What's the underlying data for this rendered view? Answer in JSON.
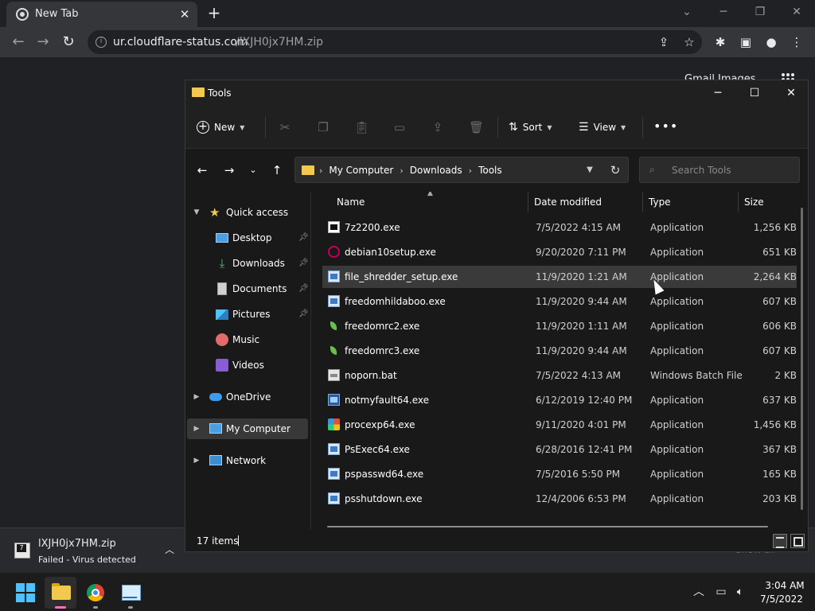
{
  "browser": {
    "tab_title": "New Tab",
    "tab_close": "✕",
    "new_tab": "+",
    "url_host": "ur.cloudflare-status.com",
    "url_path": "/lXJH0jx7HM.zip",
    "ntp_links": "Gmail   Images"
  },
  "download": {
    "filename": "lXJH0jx7HM.zip",
    "status": "Failed - Virus detected",
    "show_all": "Show all"
  },
  "explorer": {
    "title": "Tools",
    "cmd": {
      "new": "New",
      "sort": "Sort",
      "view": "View"
    },
    "breadcrumb": [
      "My Computer",
      "Downloads",
      "Tools"
    ],
    "search_placeholder": "Search Tools",
    "nav": {
      "quick_access": "Quick access",
      "desktop": "Desktop",
      "downloads": "Downloads",
      "documents": "Documents",
      "pictures": "Pictures",
      "music": "Music",
      "videos": "Videos",
      "onedrive": "OneDrive",
      "my_computer": "My Computer",
      "network": "Network"
    },
    "columns": {
      "name": "Name",
      "date": "Date modified",
      "type": "Type",
      "size": "Size"
    },
    "files": [
      {
        "name": "7z2200.exe",
        "date": "7/5/2022 4:15 AM",
        "type": "Application",
        "size": "1,256 KB",
        "icon": "7zip-icon"
      },
      {
        "name": "debian10setup.exe",
        "date": "9/20/2020 7:11 PM",
        "type": "Application",
        "size": "651 KB",
        "icon": "debian-icon"
      },
      {
        "name": "file_shredder_setup.exe",
        "date": "11/9/2020 1:21 AM",
        "type": "Application",
        "size": "2,264 KB",
        "icon": "installer-icon"
      },
      {
        "name": "freedomhildaboo.exe",
        "date": "11/9/2020 9:44 AM",
        "type": "Application",
        "size": "607 KB",
        "icon": "app-window-icon"
      },
      {
        "name": "freedomrc2.exe",
        "date": "11/9/2020 1:11 AM",
        "type": "Application",
        "size": "606 KB",
        "icon": "leaf-icon"
      },
      {
        "name": "freedomrc3.exe",
        "date": "11/9/2020 9:44 AM",
        "type": "Application",
        "size": "607 KB",
        "icon": "leaf-icon"
      },
      {
        "name": "noporn.bat",
        "date": "7/5/2022 4:13 AM",
        "type": "Windows Batch File",
        "size": "2 KB",
        "icon": "batch-file-icon"
      },
      {
        "name": "notmyfault64.exe",
        "date": "6/12/2019 12:40 PM",
        "type": "Application",
        "size": "637 KB",
        "icon": "notmyfault-icon"
      },
      {
        "name": "procexp64.exe",
        "date": "9/11/2020 4:01 PM",
        "type": "Application",
        "size": "1,456 KB",
        "icon": "procexp-icon"
      },
      {
        "name": "PsExec64.exe",
        "date": "6/28/2016 12:41 PM",
        "type": "Application",
        "size": "367 KB",
        "icon": "app-window-icon"
      },
      {
        "name": "pspasswd64.exe",
        "date": "7/5/2016 5:50 PM",
        "type": "Application",
        "size": "165 KB",
        "icon": "app-window-icon"
      },
      {
        "name": "psshutdown.exe",
        "date": "12/4/2006 6:53 PM",
        "type": "Application",
        "size": "203 KB",
        "icon": "app-window-icon"
      }
    ],
    "item_count": "17 items"
  },
  "taskbar": {
    "time": "3:04 AM",
    "date": "7/5/2022"
  },
  "colors": {
    "accent": "#4cc2ff",
    "folder": "#f2c94c",
    "selected_row": "#3a3a3a"
  }
}
